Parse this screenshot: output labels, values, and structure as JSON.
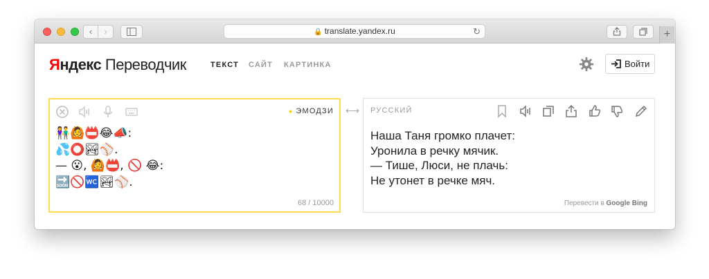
{
  "browser": {
    "url": "translate.yandex.ru",
    "new_tab_label": "+"
  },
  "header": {
    "logo_brand": "Яндекс",
    "logo_brand_first": "Я",
    "logo_brand_rest": "ндекс",
    "logo_product": "Переводчик",
    "tabs": [
      {
        "label": "ТЕКСТ",
        "active": true
      },
      {
        "label": "САЙТ",
        "active": false
      },
      {
        "label": "КАРТИНКА",
        "active": false
      }
    ],
    "login_label": "Войти"
  },
  "source": {
    "language": "ЭМОДЗИ",
    "text": "👫🙆📛😂📣:\n💦⭕🏞⚾.\n— 😮, 🙆📛, 🚫 😂:\n🔜🚫🚾🏞⚾.",
    "char_count": "68 / 10000",
    "icons": [
      "clear-icon",
      "speaker-icon",
      "microphone-icon",
      "keyboard-icon"
    ]
  },
  "target": {
    "language": "РУССКИЙ",
    "text": "Наша Таня громко плачет:\nУронила в речку мячик.\n— Тише, Люси, не плачь:\nНе утонет в речке мяч.",
    "powered_prefix": "Перевести в",
    "powered_google": "Google",
    "powered_bing": "Bing",
    "icons": [
      "bookmark-icon",
      "speaker-icon",
      "copy-icon",
      "share-icon",
      "thumbs-up-icon",
      "thumbs-down-icon",
      "edit-icon"
    ]
  },
  "colors": {
    "accent_yellow": "#ffdb4d",
    "brand_red": "#ff0000"
  }
}
